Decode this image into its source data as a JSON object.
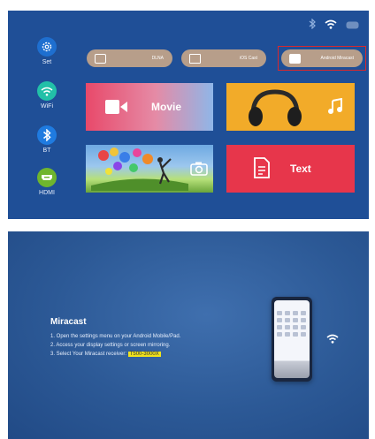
{
  "colors": {
    "screen_bg": "#1f4f97",
    "accent_red": "#d8282e",
    "set_icon": "#1e6fd0",
    "wifi_icon": "#22c0a8",
    "bt_icon": "#1f7be0",
    "hdmi_icon": "#6fb52e",
    "pill_bg": "#b79e8a",
    "movie_tile": "#e8496a",
    "music_tile": "#f2ab29",
    "text_tile": "#e7364b",
    "receiver_highlight": "#f0e21c"
  },
  "home": {
    "status_icons": [
      "bluetooth-icon",
      "wifi-icon",
      "battery-icon"
    ],
    "nav": [
      {
        "label": "Set",
        "icon": "settings-icon"
      },
      {
        "label": "WiFi",
        "icon": "wifi-icon"
      },
      {
        "label": "BT",
        "icon": "bluetooth-icon"
      },
      {
        "label": "HDMI",
        "icon": "hdmi-icon"
      }
    ],
    "pills": [
      {
        "label": "DLNA",
        "icon": "tv-icon"
      },
      {
        "label": "iOS Cast",
        "icon": "cast-icon"
      },
      {
        "label": "Android Miracast",
        "icon": "miracast-icon"
      }
    ],
    "tiles": {
      "movie": "Movie",
      "music_icon": "music-note-icon",
      "photo_icon": "camera-icon",
      "text": "Text"
    }
  },
  "miracast": {
    "title": "Miracast",
    "steps": [
      "1. Open the settings menu on your Android Mobile/Pad.",
      "2. Access your display settings or screen mirroring.",
      "3. Select Your Miracast receiver:"
    ],
    "receiver": "T500-3000X"
  }
}
